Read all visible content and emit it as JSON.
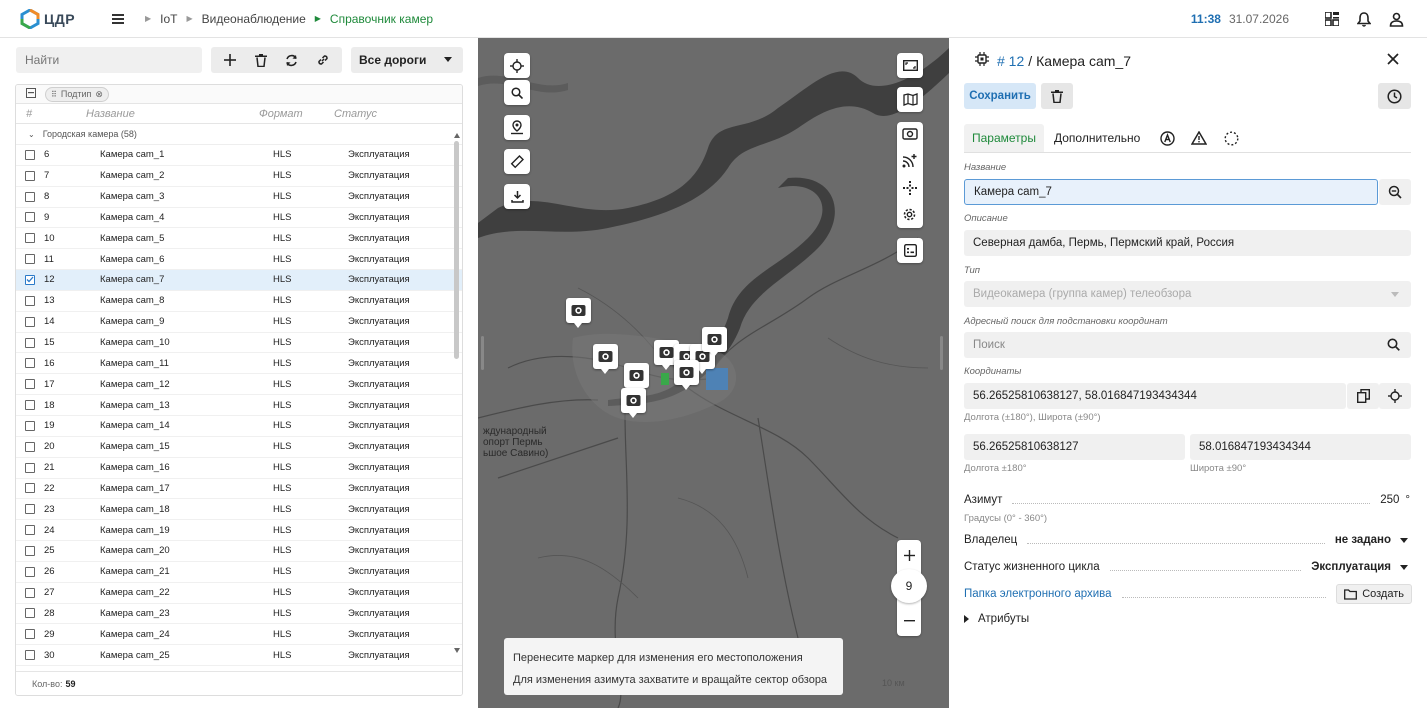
{
  "app": {
    "logo_text": "ЦДР",
    "breadcrumbs": [
      "IoT",
      "Видеонаблюдение",
      "Справочник камер"
    ],
    "time": "11:38",
    "date": "31.07.2026",
    "icons": [
      "menu-icon",
      "grid-icon",
      "bell-icon",
      "user-icon"
    ]
  },
  "left": {
    "search_placeholder": "Найти",
    "road_select": "Все дороги",
    "filter_chip": "Подтип",
    "columns": [
      "#",
      "Название",
      "Формат",
      "Статус"
    ],
    "group_label": "Городская камера (58)",
    "rows": [
      {
        "id": "6",
        "name": "Камера cam_1",
        "format": "HLS",
        "status": "Эксплуатация",
        "checked": false
      },
      {
        "id": "7",
        "name": "Камера cam_2",
        "format": "HLS",
        "status": "Эксплуатация",
        "checked": false
      },
      {
        "id": "8",
        "name": "Камера cam_3",
        "format": "HLS",
        "status": "Эксплуатация",
        "checked": false
      },
      {
        "id": "9",
        "name": "Камера cam_4",
        "format": "HLS",
        "status": "Эксплуатация",
        "checked": false
      },
      {
        "id": "10",
        "name": "Камера cam_5",
        "format": "HLS",
        "status": "Эксплуатация",
        "checked": false
      },
      {
        "id": "11",
        "name": "Камера cam_6",
        "format": "HLS",
        "status": "Эксплуатация",
        "checked": false
      },
      {
        "id": "12",
        "name": "Камера cam_7",
        "format": "HLS",
        "status": "Эксплуатация",
        "checked": true
      },
      {
        "id": "13",
        "name": "Камера cam_8",
        "format": "HLS",
        "status": "Эксплуатация",
        "checked": false
      },
      {
        "id": "14",
        "name": "Камера cam_9",
        "format": "HLS",
        "status": "Эксплуатация",
        "checked": false
      },
      {
        "id": "15",
        "name": "Камера cam_10",
        "format": "HLS",
        "status": "Эксплуатация",
        "checked": false
      },
      {
        "id": "16",
        "name": "Камера cam_11",
        "format": "HLS",
        "status": "Эксплуатация",
        "checked": false
      },
      {
        "id": "17",
        "name": "Камера cam_12",
        "format": "HLS",
        "status": "Эксплуатация",
        "checked": false
      },
      {
        "id": "18",
        "name": "Камера cam_13",
        "format": "HLS",
        "status": "Эксплуатация",
        "checked": false
      },
      {
        "id": "19",
        "name": "Камера cam_14",
        "format": "HLS",
        "status": "Эксплуатация",
        "checked": false
      },
      {
        "id": "20",
        "name": "Камера cam_15",
        "format": "HLS",
        "status": "Эксплуатация",
        "checked": false
      },
      {
        "id": "21",
        "name": "Камера cam_16",
        "format": "HLS",
        "status": "Эксплуатация",
        "checked": false
      },
      {
        "id": "22",
        "name": "Камера cam_17",
        "format": "HLS",
        "status": "Эксплуатация",
        "checked": false
      },
      {
        "id": "23",
        "name": "Камера cam_18",
        "format": "HLS",
        "status": "Эксплуатация",
        "checked": false
      },
      {
        "id": "24",
        "name": "Камера cam_19",
        "format": "HLS",
        "status": "Эксплуатация",
        "checked": false
      },
      {
        "id": "25",
        "name": "Камера cam_20",
        "format": "HLS",
        "status": "Эксплуатация",
        "checked": false
      },
      {
        "id": "26",
        "name": "Камера cam_21",
        "format": "HLS",
        "status": "Эксплуатация",
        "checked": false
      },
      {
        "id": "27",
        "name": "Камера cam_22",
        "format": "HLS",
        "status": "Эксплуатация",
        "checked": false
      },
      {
        "id": "28",
        "name": "Камера cam_23",
        "format": "HLS",
        "status": "Эксплуатация",
        "checked": false
      },
      {
        "id": "29",
        "name": "Камера cam_24",
        "format": "HLS",
        "status": "Эксплуатация",
        "checked": false
      },
      {
        "id": "30",
        "name": "Камера cam_25",
        "format": "HLS",
        "status": "Эксплуатация",
        "checked": false
      }
    ],
    "count_label": "Кол-во:",
    "count_value": "59"
  },
  "map": {
    "zoom_level": "9",
    "place_label": "ждународный\nопорт Пермь\nьшое Савино)",
    "scale_label": "10 км",
    "tooltip_line1": "Перенесите маркер для изменения его местоположения",
    "tooltip_line2": "Для изменения азимута захватите и вращайте сектор обзора"
  },
  "right": {
    "id_label": "# 12",
    "title_sep": "/",
    "title": "Камера cam_7",
    "save_label": "Сохранить",
    "tabs": [
      "Параметры",
      "Дополнительно"
    ],
    "name_label": "Название",
    "name_value": "Камера cam_7",
    "desc_label": "Описание",
    "desc_value": "Северная дамба, Пермь, Пермский край, Россия",
    "type_label": "Тип",
    "type_value": "Видеокамера (группа камер) телеобзора",
    "addr_label": "Адресный поиск для подстановки координат",
    "addr_placeholder": "Поиск",
    "coords_label": "Координаты",
    "coords_value": "56.26525810638127, 58.016847193434344",
    "coords_hint": "Долгота (±180°), Широта (±90°)",
    "lon_value": "56.26525810638127",
    "lon_hint": "Долгота ±180°",
    "lat_value": "58.016847193434344",
    "lat_hint": "Широта ±90°",
    "azimuth_label": "Азимут",
    "azimuth_value": "250",
    "azimuth_unit": "°",
    "azimuth_hint": "Градусы (0° - 360°)",
    "owner_label": "Владелец",
    "owner_value": "не задано",
    "lifecycle_label": "Статус жизненного цикла",
    "lifecycle_value": "Эксплуатация",
    "archive_label": "Папка электронного архива",
    "create_label": "Создать",
    "attributes_label": "Атрибуты"
  },
  "colors": {
    "accent_green": "#1f8a3b",
    "accent_blue": "#1f6fb2",
    "map_bg": "#6f6f6f"
  }
}
